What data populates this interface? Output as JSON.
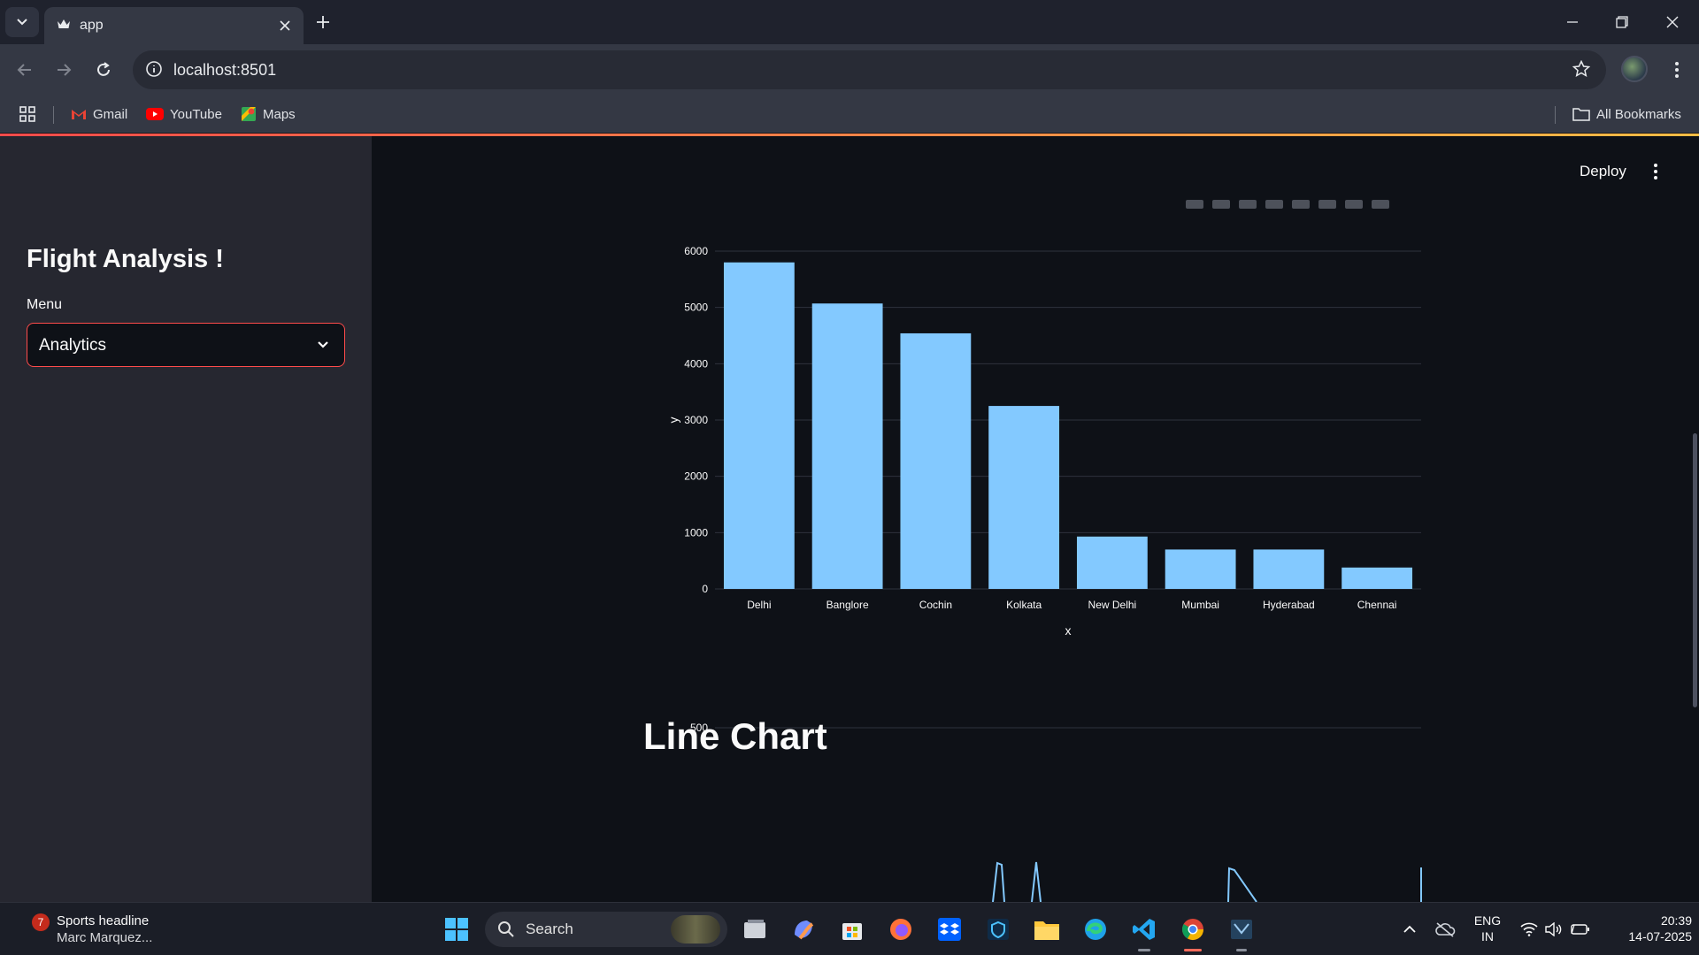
{
  "browser": {
    "tab_title": "app",
    "url": "localhost:8501",
    "bookmarks": [
      "Gmail",
      "YouTube",
      "Maps"
    ],
    "all_bookmarks": "All Bookmarks"
  },
  "sidebar": {
    "title": "Flight Analysis !",
    "menu_label": "Menu",
    "menu_value": "Analytics"
  },
  "header": {
    "deploy_label": "Deploy"
  },
  "main": {
    "section_title": "Line Chart"
  },
  "chart_data": [
    {
      "type": "bar",
      "categories": [
        "Delhi",
        "Banglore",
        "Cochin",
        "Kolkata",
        "New Delhi",
        "Mumbai",
        "Hyderabad",
        "Chennai"
      ],
      "values": [
        5800,
        5070,
        4540,
        3250,
        930,
        700,
        700,
        380
      ],
      "xlabel": "x",
      "ylabel": "y",
      "ylim": [
        0,
        6000
      ],
      "yticks": [
        0,
        1000,
        2000,
        3000,
        4000,
        5000,
        6000
      ],
      "color": "#83c9ff",
      "grid": true
    },
    {
      "type": "line",
      "title": "Line Chart",
      "yticks_visible": [
        500
      ],
      "color": "#83c9ff",
      "partially_visible": true
    }
  ],
  "taskbar": {
    "news_count": "7",
    "news_title": "Sports headline",
    "news_subtitle": "Marc Marquez...",
    "search_placeholder": "Search",
    "language": "ENG",
    "region": "IN",
    "time": "20:39",
    "date": "14-07-2025"
  },
  "colors": {
    "accent": "#ff4b4b",
    "bar": "#83c9ff",
    "background": "#0e1117",
    "sidebar": "#262730"
  }
}
